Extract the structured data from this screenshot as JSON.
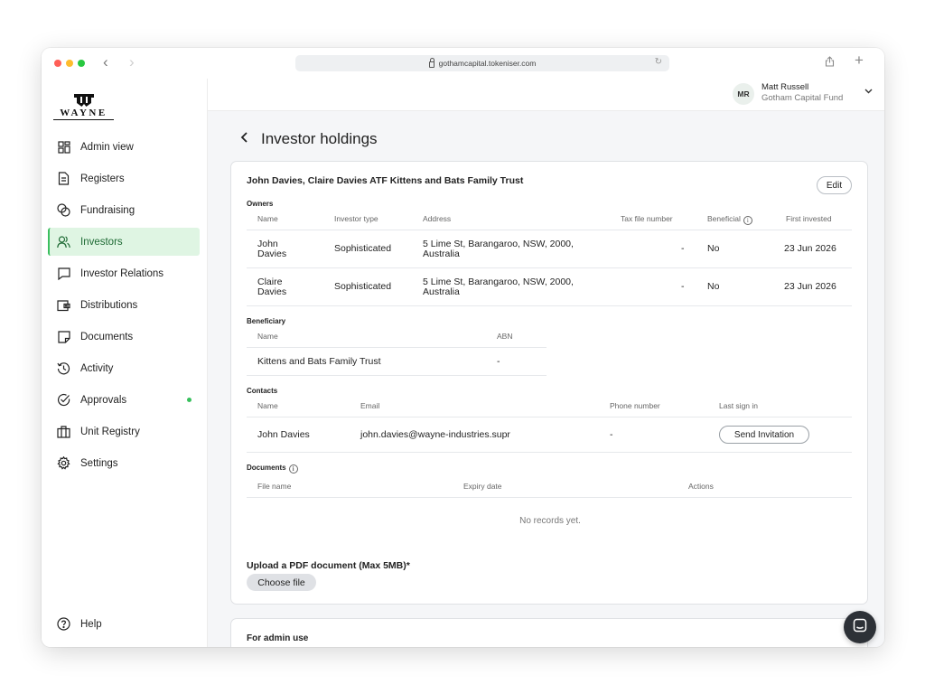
{
  "browser": {
    "url": "gothamcapital.tokeniser.com"
  },
  "logo": {
    "wordmark": "WAYNE"
  },
  "sidebar": {
    "items": [
      {
        "label": "Admin view",
        "icon": "dashboard-icon"
      },
      {
        "label": "Registers",
        "icon": "document-icon"
      },
      {
        "label": "Fundraising",
        "icon": "coins-icon"
      },
      {
        "label": "Investors",
        "icon": "users-icon",
        "active": true
      },
      {
        "label": "Investor Relations",
        "icon": "chat-icon"
      },
      {
        "label": "Distributions",
        "icon": "wallet-icon"
      },
      {
        "label": "Documents",
        "icon": "note-icon"
      },
      {
        "label": "Activity",
        "icon": "history-icon"
      },
      {
        "label": "Approvals",
        "icon": "check-circle-icon",
        "badge": true
      },
      {
        "label": "Unit Registry",
        "icon": "briefcase-icon"
      },
      {
        "label": "Settings",
        "icon": "gear-icon"
      }
    ],
    "help_label": "Help"
  },
  "user": {
    "initials": "MR",
    "name": "Matt Russell",
    "fund": "Gotham Capital Fund"
  },
  "page": {
    "title": "Investor holdings"
  },
  "holding": {
    "title": "John Davies, Claire Davies ATF Kittens and Bats Family Trust",
    "edit_label": "Edit",
    "owners": {
      "label": "Owners",
      "headers": [
        "Name",
        "Investor type",
        "Address",
        "Tax file number",
        "Beneficial",
        "First invested"
      ],
      "rows": [
        {
          "name_line1": "John",
          "name_line2": "Davies",
          "type": "Sophisticated",
          "address_line1": "5 Lime St, Barangaroo, NSW, 2000,",
          "address_line2": "Australia",
          "tfn": "-",
          "beneficial": "No",
          "first_invested": "23 Jun 2026"
        },
        {
          "name_line1": "Claire",
          "name_line2": "Davies",
          "type": "Sophisticated",
          "address_line1": "5 Lime St, Barangaroo, NSW, 2000,",
          "address_line2": "Australia",
          "tfn": "-",
          "beneficial": "No",
          "first_invested": "23 Jun 2026"
        }
      ]
    },
    "beneficiary": {
      "label": "Beneficiary",
      "headers": [
        "Name",
        "ABN"
      ],
      "row": {
        "name": "Kittens and Bats Family Trust",
        "abn": "-"
      }
    },
    "contacts": {
      "label": "Contacts",
      "headers": [
        "Name",
        "Email",
        "Phone number",
        "Last sign in"
      ],
      "row": {
        "name": "John Davies",
        "email": "john.davies@wayne-industries.supr",
        "phone": "-",
        "action_label": "Send Invitation"
      }
    },
    "documents": {
      "label": "Documents",
      "headers": [
        "File name",
        "Expiry date",
        "Actions"
      ],
      "empty_text": "No records yet."
    },
    "upload": {
      "label": "Upload a PDF document (Max 5MB)*",
      "button_label": "Choose file"
    }
  },
  "admin_card": {
    "title": "For admin use"
  },
  "colors": {
    "active_bg": "#dff5e3",
    "active_accent": "#3bbf5f",
    "badge": "#37c05c"
  }
}
